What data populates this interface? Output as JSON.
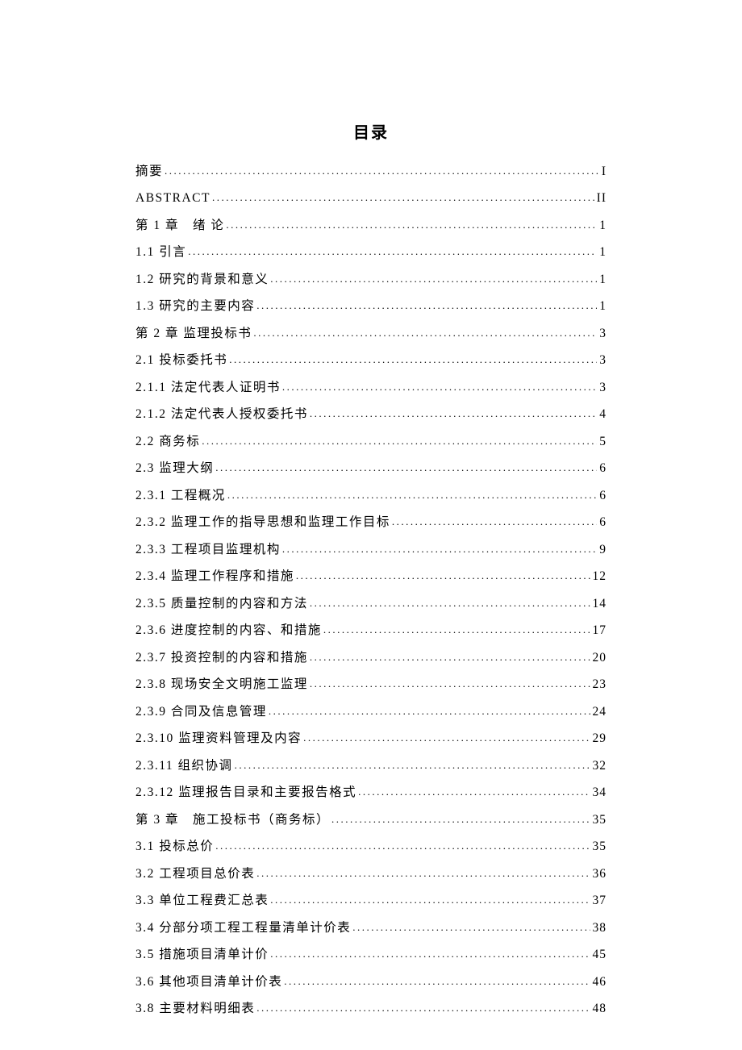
{
  "title": "目录",
  "entries": [
    {
      "label": "摘要",
      "page": "I"
    },
    {
      "label": "ABSTRACT",
      "page": "II"
    },
    {
      "label": "第 1 章　绪 论",
      "page": "1"
    },
    {
      "label": "1.1 引言",
      "page": "1"
    },
    {
      "label": "1.2 研究的背景和意义",
      "page": "1"
    },
    {
      "label": "1.3 研究的主要内容",
      "page": "1"
    },
    {
      "label": "第 2 章 监理投标书",
      "page": "3"
    },
    {
      "label": "2.1 投标委托书",
      "page": "3"
    },
    {
      "label": "2.1.1 法定代表人证明书",
      "page": "3"
    },
    {
      "label": "2.1.2 法定代表人授权委托书",
      "page": "4"
    },
    {
      "label": "2.2 商务标",
      "page": "5"
    },
    {
      "label": "2.3 监理大纲",
      "page": "6"
    },
    {
      "label": "2.3.1 工程概况",
      "page": "6"
    },
    {
      "label": "2.3.2 监理工作的指导思想和监理工作目标",
      "page": "6"
    },
    {
      "label": "2.3.3 工程项目监理机构",
      "page": "9"
    },
    {
      "label": "2.3.4 监理工作程序和措施",
      "page": "12"
    },
    {
      "label": "2.3.5 质量控制的内容和方法",
      "page": "14"
    },
    {
      "label": "2.3.6 进度控制的内容、和措施",
      "page": "17"
    },
    {
      "label": "2.3.7 投资控制的内容和措施",
      "page": "20"
    },
    {
      "label": "2.3.8 现场安全文明施工监理",
      "page": "23"
    },
    {
      "label": "2.3.9 合同及信息管理",
      "page": "24"
    },
    {
      "label": "2.3.10 监理资料管理及内容",
      "page": "29"
    },
    {
      "label": "2.3.11 组织协调",
      "page": "32"
    },
    {
      "label": "2.3.12 监理报告目录和主要报告格式",
      "page": "34"
    },
    {
      "label": "第 3 章　施工投标书（商务标）",
      "page": "35"
    },
    {
      "label": "3.1 投标总价",
      "page": "35"
    },
    {
      "label": "3.2 工程项目总价表",
      "page": "36"
    },
    {
      "label": "3.3 单位工程费汇总表",
      "page": "37"
    },
    {
      "label": "3.4 分部分项工程工程量清单计价表",
      "page": "38"
    },
    {
      "label": "3.5 措施项目清单计价",
      "page": "45"
    },
    {
      "label": "3.6 其他项目清单计价表",
      "page": "46"
    },
    {
      "label": "3.8 主要材料明细表",
      "page": "48"
    }
  ]
}
